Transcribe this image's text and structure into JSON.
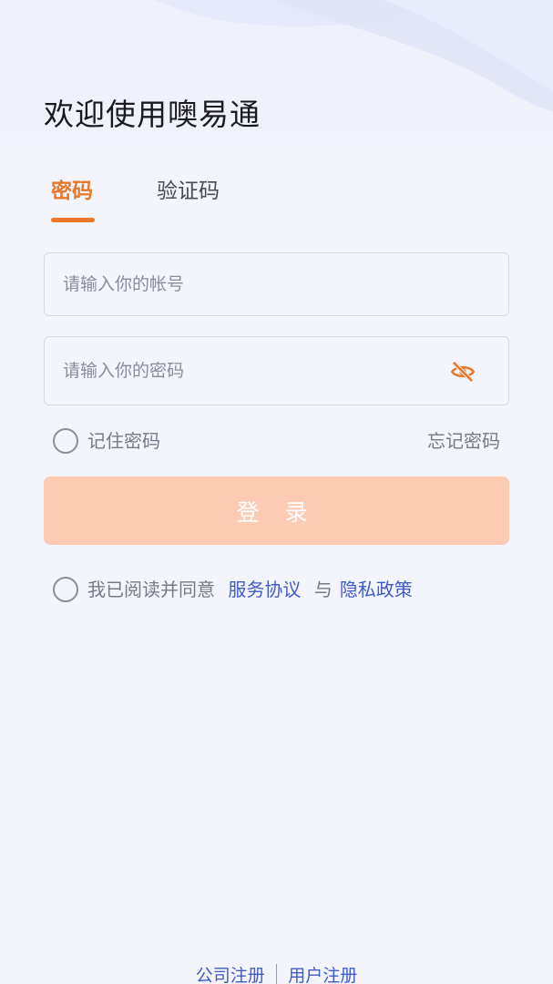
{
  "header": {
    "title": "欢迎使用噢易通"
  },
  "tabs": {
    "password_label": "密码",
    "code_label": "验证码",
    "active": "password"
  },
  "form": {
    "account_placeholder": "请输入你的帐号",
    "password_placeholder": "请输入你的密码",
    "eye_icon": "eye-off-icon",
    "remember_label": "记住密码",
    "forgot_label": "忘记密码",
    "login_label": "登 录"
  },
  "agreement": {
    "prefix": "我已阅读并同意",
    "service_link": "服务协议",
    "conjunction": "与",
    "privacy_link": "隐私政策"
  },
  "footer": {
    "company_register": "公司注册",
    "user_register": "用户注册"
  },
  "colors": {
    "accent": "#e8772a",
    "login_button": "#fdcbb4",
    "link": "#3e5cc4",
    "background": "#f4f5fc"
  }
}
